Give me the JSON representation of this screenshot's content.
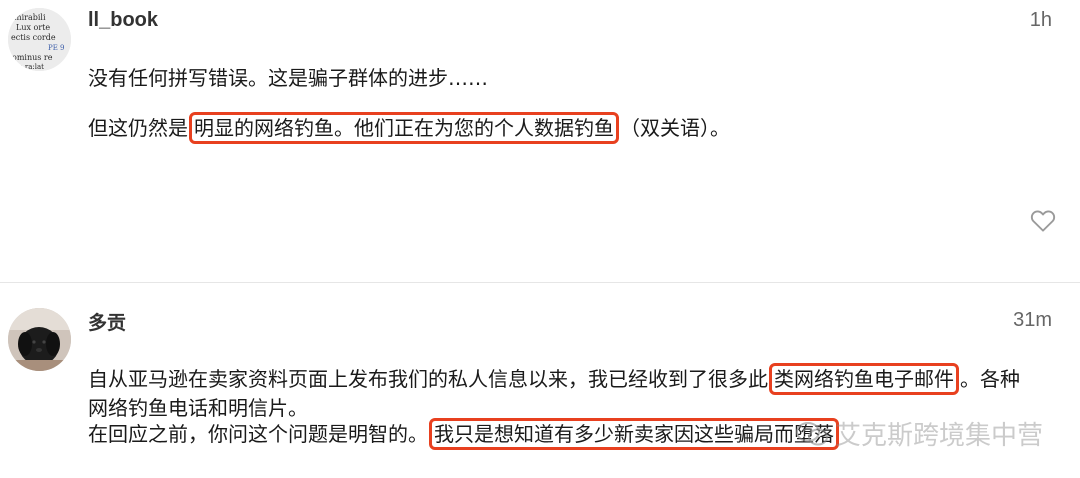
{
  "comments": [
    {
      "username": "ll_book",
      "time": "1h",
      "avatar_text": [
        "mirabili",
        "Lux  orte",
        "ectis corde",
        "PE 9",
        "ominus  re",
        "m ra:lat"
      ],
      "line1": "没有任何拼写错误。这是骗子群体的进步……",
      "line2": {
        "pre": "但这仍然是",
        "hl": "明显的网络钓鱼。他们正在为您的个人数据钓鱼",
        "post": "（双关语）。"
      }
    },
    {
      "username": "多贡",
      "time": "31m",
      "line1": {
        "pre": "自从亚马逊在卖家资料页面上发布我们的私人信息以来，我已经收到了很多此",
        "hl": "类网络钓鱼电子邮件",
        "post": "。各种"
      },
      "line2": "网络钓鱼电话和明信片。",
      "line3": {
        "pre": "在回应之前，你问这个问题是明智的。",
        "hl": "我只是想知道有多少新卖家因这些骗局而堕落"
      }
    }
  ],
  "watermark": "艾克斯跨境集中营",
  "colors": {
    "highlight_border": "#e8401f",
    "username": "#333333",
    "time": "#666666",
    "text": "#1a1a1a"
  },
  "icons": {
    "like": "heart-icon",
    "watermark_logo": "wechat-icon"
  }
}
